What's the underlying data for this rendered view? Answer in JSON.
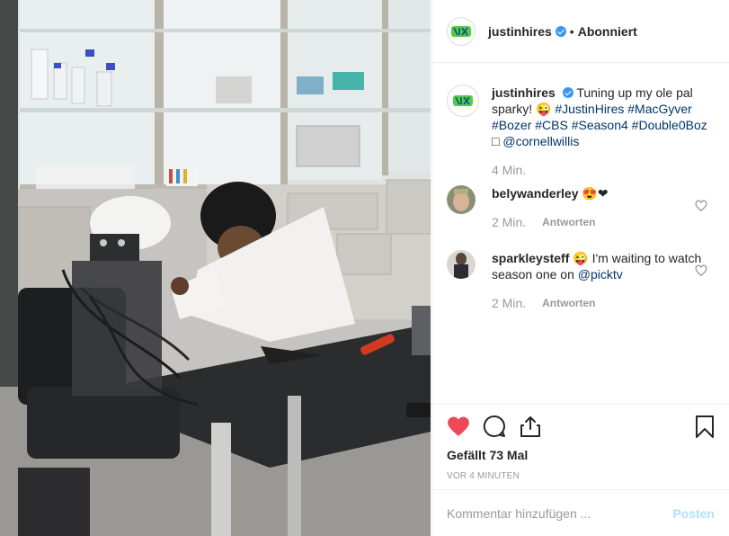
{
  "post": {
    "image_alt": "",
    "author": {
      "username": "justinhires",
      "verified": true,
      "follow_state": "Abonniert",
      "avatar_icon": "green-graffiti-logo"
    }
  },
  "caption": {
    "username": "justinhires",
    "text_plain": "Tuning up my ole pal sparky! 😜",
    "hashtags": [
      "#JustinHires",
      "#MacGyver",
      "#Bozer",
      "#CBS",
      "#Season4",
      "#Double0Boz"
    ],
    "trailing_symbol": "□",
    "mention": "@cornellwillis",
    "time": "4 Min."
  },
  "comments": [
    {
      "username": "belywanderley",
      "text": "😍❤",
      "time": "2 Min.",
      "reply_label": "Antworten",
      "avatar_icon": "user-avatar-hand",
      "like_icon": "heart-outline-icon"
    },
    {
      "username": "sparkleysteff",
      "text": "😜 I'm waiting to watch season one on ",
      "mention": "@picktv",
      "time": "2 Min.",
      "reply_label": "Antworten",
      "avatar_icon": "user-avatar-person",
      "like_icon": "heart-outline-icon"
    }
  ],
  "actions": {
    "like_icon": "heart-filled-icon",
    "comment_icon": "comment-bubble-icon",
    "share_icon": "share-upload-icon",
    "save_icon": "bookmark-icon",
    "likes_text": "Gefällt 73 Mal",
    "time_ago": "VOR 4 MINUTEN"
  },
  "add_comment": {
    "placeholder": "Kommentar hinzufügen ...",
    "post_label": "Posten"
  },
  "colors": {
    "like_red": "#ed4956",
    "link_blue": "#003569",
    "verified_blue": "#3897f0",
    "post_disabled": "#b2dffc",
    "meta_gray": "#999999"
  }
}
